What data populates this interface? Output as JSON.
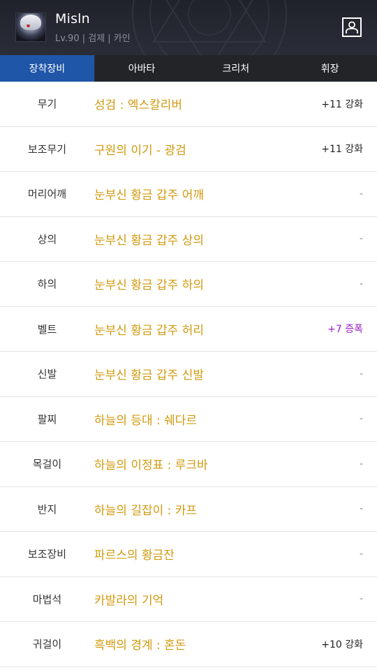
{
  "character": {
    "name": "Misln",
    "info": "Lv.90 | 검제 | 카인"
  },
  "header_icons": {
    "avatar": "character-portrait",
    "profile": "profile-icon"
  },
  "tabs": [
    {
      "label": "장착장비",
      "active": true
    },
    {
      "label": "아바타",
      "active": false
    },
    {
      "label": "크리처",
      "active": false
    },
    {
      "label": "휘장",
      "active": false
    }
  ],
  "colors": {
    "accent_tab": "#1f56a8",
    "item_name": "#d19a0e",
    "amplify": "#9b1fc2"
  },
  "equipment": [
    {
      "slot": "무기",
      "item": "성검 : 엑스칼리버",
      "upgrade": "+11 강화",
      "type": "reinforce"
    },
    {
      "slot": "보조무기",
      "item": "구원의 이기 - 광검",
      "upgrade": "+11 강화",
      "type": "reinforce"
    },
    {
      "slot": "머리어깨",
      "item": "눈부신 황금 갑주 어깨",
      "upgrade": "-",
      "type": "none"
    },
    {
      "slot": "상의",
      "item": "눈부신 황금 갑주 상의",
      "upgrade": "-",
      "type": "none"
    },
    {
      "slot": "하의",
      "item": "눈부신 황금 갑주 하의",
      "upgrade": "-",
      "type": "none"
    },
    {
      "slot": "벨트",
      "item": "눈부신 황금 갑주 허리",
      "upgrade": "+7 증폭",
      "type": "amplify"
    },
    {
      "slot": "신발",
      "item": "눈부신 황금 갑주 신발",
      "upgrade": "-",
      "type": "none"
    },
    {
      "slot": "팔찌",
      "item": "하늘의 등대 : 쉐다르",
      "upgrade": "-",
      "type": "none"
    },
    {
      "slot": "목걸이",
      "item": "하늘의 이정표 : 루크바",
      "upgrade": "-",
      "type": "none"
    },
    {
      "slot": "반지",
      "item": "하늘의 길잡이 : 카프",
      "upgrade": "-",
      "type": "none"
    },
    {
      "slot": "보조장비",
      "item": "파르스의 황금잔",
      "upgrade": "-",
      "type": "none"
    },
    {
      "slot": "마법석",
      "item": "카발라의 기억",
      "upgrade": "-",
      "type": "none"
    },
    {
      "slot": "귀걸이",
      "item": "흑백의 경계 : 혼돈",
      "upgrade": "+10 강화",
      "type": "reinforce"
    }
  ]
}
